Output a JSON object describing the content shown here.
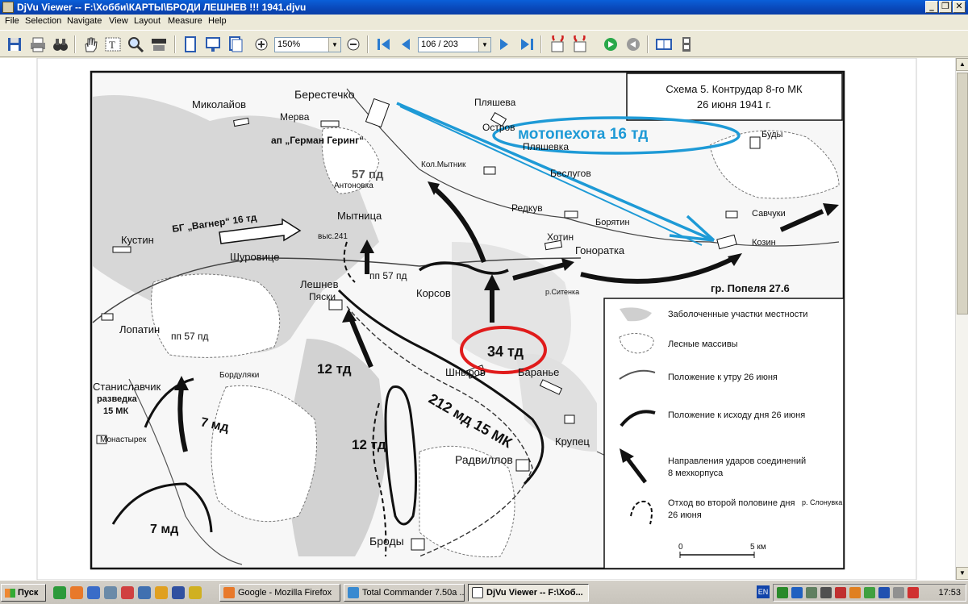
{
  "window": {
    "title": "DjVu Viewer -- F:\\Хобби\\КАРТЫ\\БРОДИ ЛЕШНЕВ !!! 1941.djvu",
    "min_label": "_",
    "max_label": "❐",
    "close_label": "✕"
  },
  "menu": [
    "File",
    "Selection",
    "Navigate",
    "View",
    "Layout",
    "Measure",
    "Help"
  ],
  "toolbar": {
    "zoom_value": "150%",
    "page_value": "106 / 203"
  },
  "map": {
    "title_line1": "Схема 5. Контрудар 8-го МК",
    "title_line2": "26 июня 1941 г.",
    "annotation_blue": "мотопехота 16 тд",
    "annotation_red": "34 тд",
    "places": {
      "berestechko": "Берестечко",
      "mykolaiv": "Миколайов",
      "merva": "Мерва",
      "plyasheva": "Пляшева",
      "ostrov": "Остров",
      "plyashevka": "Пляшевка",
      "budy": "Буды",
      "german_gering": "ап „Герман Геринг“",
      "pd57a": "57 пд",
      "antonovka": "Антоновка",
      "kol_mytnik": "Кол.Мытник",
      "beslugov": "Беслугов",
      "savchuki": "Савчуки",
      "mytnitsa": "Мытница",
      "redkuv": "Редкув",
      "boryatin": "Борятин",
      "khotin": "Хотин",
      "kozin": "Козин",
      "bg_wagner": "БГ „Вагнер“ 16 тд",
      "kustin": "Кустин",
      "vys241": "выс.241",
      "shurovitse": "Шуровице",
      "gonoratka": "Гонoратка",
      "pp57b": "пп 57 пд",
      "leshnev": "Лешнев",
      "pyaski": "Пяски",
      "korsov": "Корсов",
      "gr_popel": "гр. Попеля 27.6",
      "lopatin": "Лопатин",
      "pp57c": "пп 57 пд",
      "td12a": "12 тд",
      "shnyrov": "Шныров",
      "baranye": "Баранье",
      "stanislavchik": "Станиславчик",
      "bordulyaki": "Бордуляки",
      "razvedka": "разведка",
      "mk15": "15 МК",
      "md7a": "7 мд",
      "md212": "212 мд 15 МК",
      "td12b": "12 тд",
      "krupets": "Крупец",
      "monastyrek": "Монастырек",
      "radvillov": "Радвиллов",
      "slonuvka": "р. Слонувка",
      "md7b": "7 мд",
      "brody": "Броды",
      "sytenka": "р.Ситенка"
    },
    "legend": [
      "Заболоченные участки местности",
      "Лесные массивы",
      "Положение к утру 26 июня",
      "Положение к исходу дня 26 июня",
      "Направления ударов соединений",
      "8 мехкорпуса",
      "Отход во второй половине дня",
      "26 июня"
    ],
    "scale_zero": "0",
    "scale_km": "5 км",
    "colors": {
      "blue_annotation": "#1e9ad6",
      "red_annotation": "#e01b1b"
    }
  },
  "taskbar": {
    "start_label": "Пуск",
    "tasks": [
      "Google - Mozilla Firefox",
      "Total Commander 7.50a ...",
      "DjVu Viewer -- F:\\Хоб..."
    ],
    "lang": "EN",
    "clock": "17:53"
  }
}
